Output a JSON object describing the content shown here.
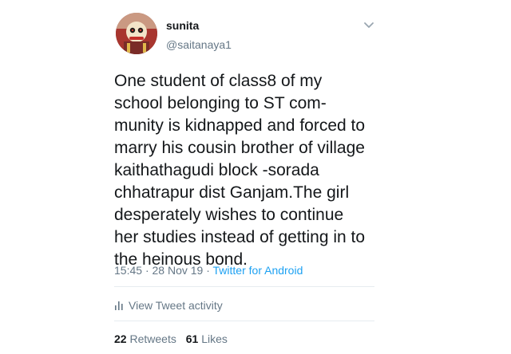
{
  "tweet": {
    "author_name": "sunita",
    "author_handle": "@saitanaya1",
    "text": "One student of  class8 of my\nschool belonging to ST com-\nmunity is kidnapped and forced to\nmarry his cousin brother of village\nkaithathagudi block -sorada\nchhatrapur dist Ganjam.The girl\ndesperately wishes to continue\nher studies instead of getting in to\nthe heinous bond.",
    "time": "15:45",
    "date": "28 Nov 19",
    "separator": "·",
    "source": "Twitter for Android",
    "view_activity": "View Tweet activity",
    "retweets_count": "22",
    "retweets_label": "Retweets",
    "likes_count": "61",
    "likes_label": "Likes"
  },
  "icons": {
    "menu": "chevron-down-icon",
    "activity": "bar-chart-icon"
  },
  "colors": {
    "link": "#1da1f2",
    "secondary_text": "#657786",
    "primary_text": "#14171a"
  }
}
